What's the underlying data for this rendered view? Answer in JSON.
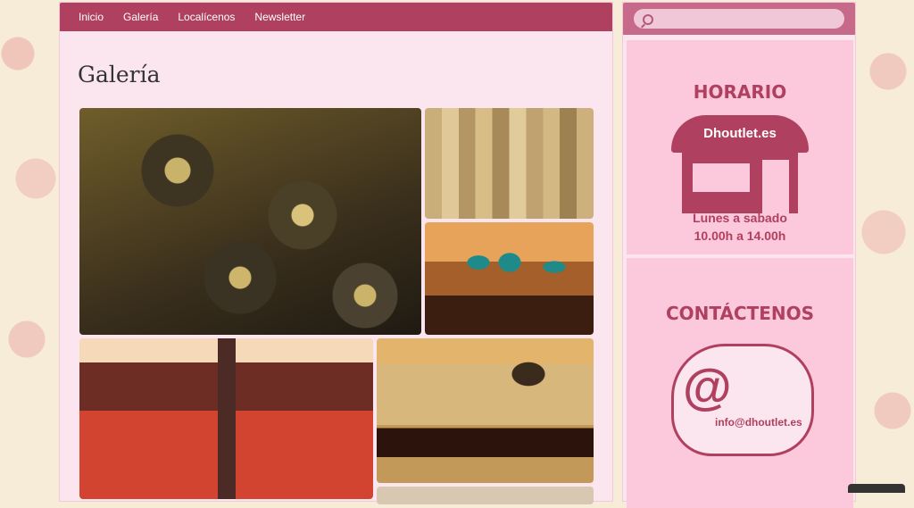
{
  "nav": [
    "Inicio",
    "Galería",
    "Localícenos",
    "Newsletter"
  ],
  "page": {
    "title": "Galería"
  },
  "gallery": {
    "count": 6
  },
  "sidebar": {
    "search": {
      "placeholder": ""
    },
    "horario": {
      "title": "HORARIO",
      "shop_name": "Dhoutlet.es",
      "line1": "Lunes a sabado",
      "line2": "10.00h a 14.00h"
    },
    "contact": {
      "title": "CONTÁCTENOS",
      "email": "info@dhoutlet.es"
    }
  },
  "colors": {
    "accent": "#b0405f",
    "sidebar_bg": "#fbc8dc",
    "content_bg": "#fbe5ef"
  }
}
